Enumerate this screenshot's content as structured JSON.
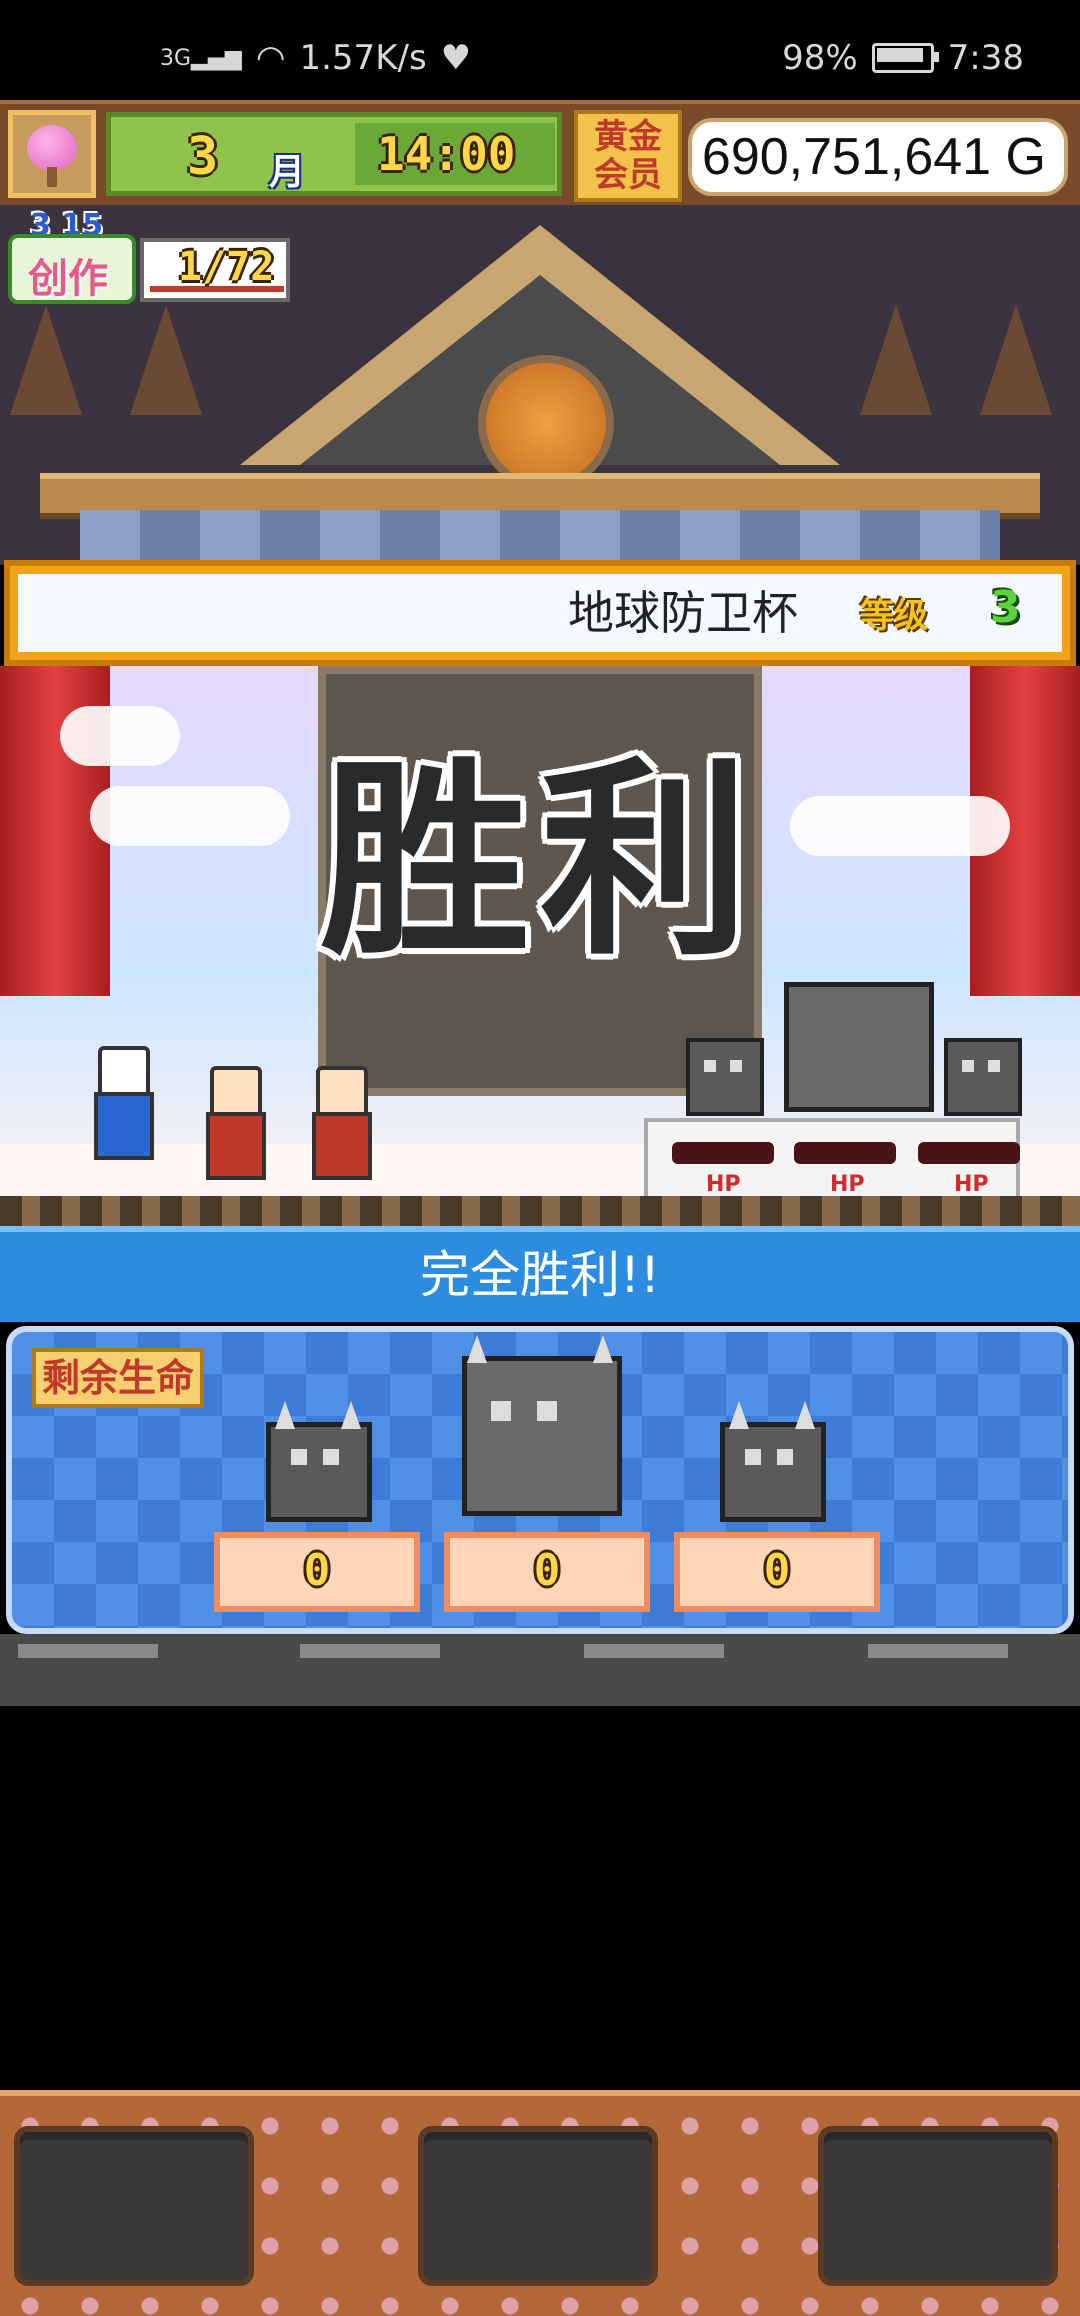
{
  "status_bar": {
    "network": "3G",
    "speed": "1.57K/s",
    "battery_percent": "98%",
    "time": "7:38"
  },
  "hud": {
    "month_number": "3",
    "month_label": "月",
    "clock": "14:00",
    "membership_badge": "黄金会员",
    "money": "690,751,641 G"
  },
  "creation": {
    "label": "创作",
    "small_numbers": "3 15",
    "progress": "1/72"
  },
  "banner": {
    "cup_title": "地球防卫杯",
    "level_label": "等级",
    "level_value": "3"
  },
  "stage": {
    "victory_text": "胜利",
    "hp_labels": [
      "HP",
      "HP",
      "HP"
    ]
  },
  "result": {
    "header": "完全胜利!!",
    "remaining_label": "剩余生命",
    "enemy_remaining": [
      "0",
      "0",
      "0"
    ]
  },
  "icons": {
    "avatar": "pink-tree-icon",
    "wifi": "wifi-icon",
    "signal": "signal-icon",
    "health": "heart-icon",
    "battery": "battery-icon"
  },
  "colors": {
    "accent_blue": "#2c8de0",
    "gold": "#f1a218",
    "hp_red": "#d42a2a"
  }
}
